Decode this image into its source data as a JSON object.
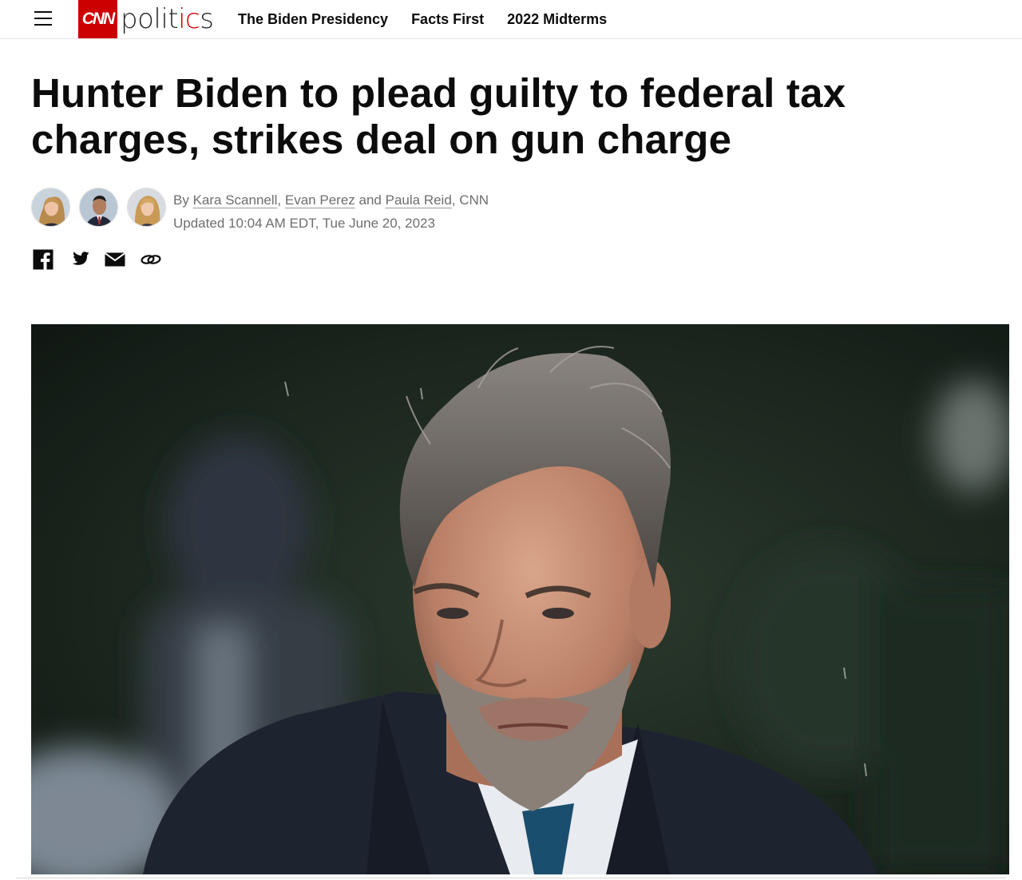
{
  "header": {
    "menu_label": "Menu",
    "logo": {
      "brand": "CNN",
      "section_prefix": "polit",
      "section_accent": "ic",
      "section_suffix": "s"
    },
    "nav": [
      {
        "label": "The Biden Presidency"
      },
      {
        "label": "Facts First"
      },
      {
        "label": "2022 Midterms"
      }
    ]
  },
  "article": {
    "headline": "Hunter Biden to plead guilty to federal tax charges, strikes deal on gun charge",
    "byline": {
      "prefix": "By",
      "authors": [
        "Kara Scannell",
        "Evan Perez",
        "Paula Reid"
      ],
      "sep1": ",",
      "conj": "and",
      "suffix": ", CNN",
      "updated": "Updated 10:04 AM EDT, Tue June 20, 2023"
    },
    "share": [
      {
        "icon": "facebook-icon"
      },
      {
        "icon": "twitter-icon"
      },
      {
        "icon": "email-icon"
      },
      {
        "icon": "link-icon"
      }
    ]
  },
  "colors": {
    "brand_red": "#cc0000",
    "text": "#0c0c0c",
    "meta_gray": "#6e6e6e"
  }
}
